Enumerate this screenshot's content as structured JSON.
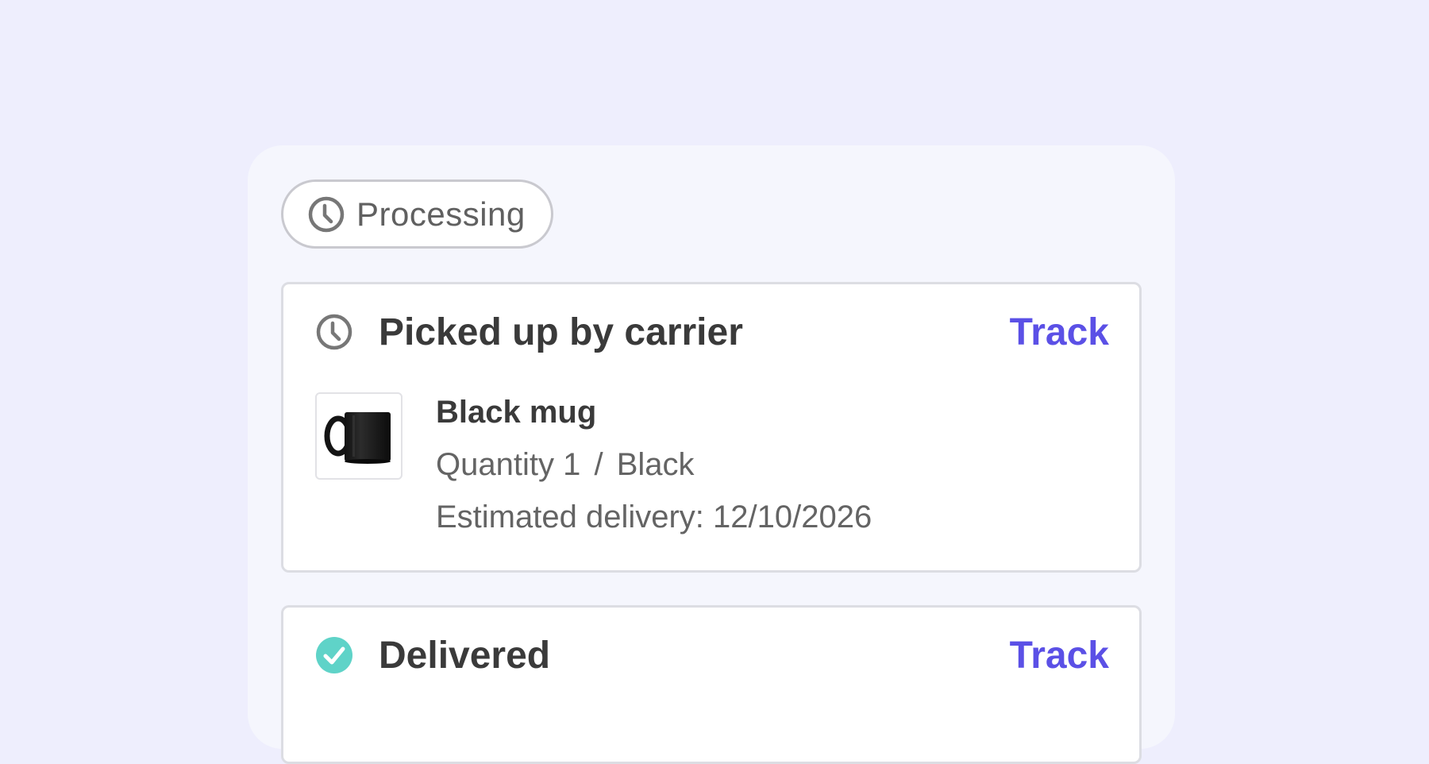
{
  "status": {
    "label": "Processing",
    "icon": "clock-icon"
  },
  "shipments": [
    {
      "status_title": "Picked up by carrier",
      "status_icon": "clock-icon",
      "track_label": "Track",
      "item": {
        "name": "Black mug",
        "quantity_label": "Quantity 1",
        "separator": "/",
        "variant": "Black",
        "eta_label": "Estimated delivery:",
        "eta_date": "12/10/2026"
      }
    },
    {
      "status_title": "Delivered",
      "status_icon": "check-circle-icon",
      "track_label": "Track"
    }
  ],
  "colors": {
    "accent": "#5b50e6",
    "delivered": "#5fd3c8",
    "background": "#eeeefd",
    "panel": "#f5f6fd"
  }
}
